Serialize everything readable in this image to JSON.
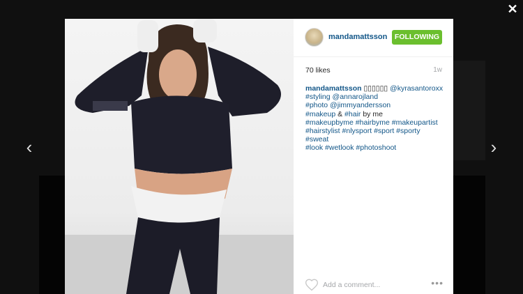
{
  "nav": {
    "close": "✕",
    "prev": "‹",
    "next": "›"
  },
  "post": {
    "username": "mandamattsson",
    "follow_label": "FOLLOWING",
    "likes": "70 likes",
    "age": "1w",
    "caption": {
      "user": "mandamattsson",
      "hidden_glyphs": "▯▯▯▯▯▯",
      "lines": [
        [
          {
            "t": "@kyrasantoroxx",
            "link": true
          }
        ],
        [
          {
            "t": "#styling",
            "link": true
          },
          {
            "t": " ",
            "link": false
          },
          {
            "t": "@annarojland",
            "link": true
          }
        ],
        [
          {
            "t": "#photo",
            "link": true
          },
          {
            "t": " ",
            "link": false
          },
          {
            "t": "@jimmyandersson",
            "link": true
          }
        ],
        [
          {
            "t": "#makeup",
            "link": true
          },
          {
            "t": " & ",
            "link": false
          },
          {
            "t": "#hair",
            "link": true
          },
          {
            "t": " by me",
            "link": false
          }
        ],
        [
          {
            "t": "#makeupbyme",
            "link": true
          },
          {
            "t": " ",
            "link": false
          },
          {
            "t": "#hairbyme",
            "link": true
          },
          {
            "t": " ",
            "link": false
          },
          {
            "t": "#makeupartist",
            "link": true
          }
        ],
        [
          {
            "t": "#hairstylist",
            "link": true
          },
          {
            "t": " ",
            "link": false
          },
          {
            "t": "#nlysport",
            "link": true
          },
          {
            "t": " ",
            "link": false
          },
          {
            "t": "#sport",
            "link": true
          },
          {
            "t": " ",
            "link": false
          },
          {
            "t": "#sporty",
            "link": true
          },
          {
            "t": " ",
            "link": false
          },
          {
            "t": "#sweat",
            "link": true
          }
        ],
        [
          {
            "t": "#look",
            "link": true
          },
          {
            "t": " ",
            "link": false
          },
          {
            "t": "#wetlook",
            "link": true
          },
          {
            "t": " ",
            "link": false
          },
          {
            "t": "#photoshoot",
            "link": true
          }
        ]
      ]
    },
    "comment_placeholder": "Add a comment...",
    "more_label": "•••"
  },
  "icons": {
    "heart": "heart-icon",
    "close": "close-icon",
    "prev": "chevron-left-icon",
    "next": "chevron-right-icon"
  },
  "colors": {
    "link": "#125688",
    "follow": "#6bbf2e",
    "overlay": "rgba(0,0,0,0.72)"
  }
}
